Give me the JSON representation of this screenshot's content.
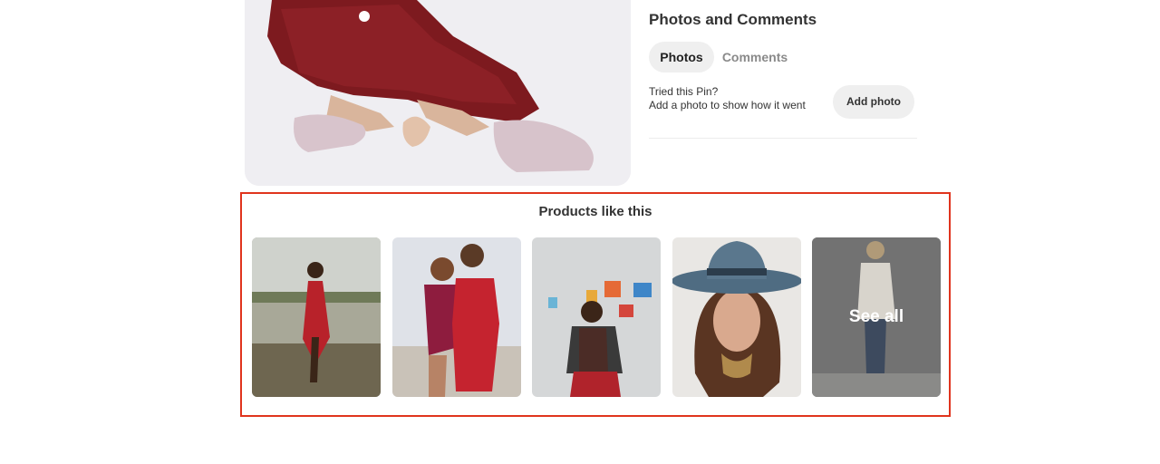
{
  "pin_image": {
    "alt_icon": "pin-photo-red-floral-dress"
  },
  "panel": {
    "title": "Photos and Comments",
    "tabs": [
      {
        "label": "Photos",
        "active": true
      },
      {
        "label": "Comments",
        "active": false
      }
    ],
    "tried_line1": "Tried this Pin?",
    "tried_line2": "Add a photo to show how it went",
    "add_photo_label": "Add photo"
  },
  "products": {
    "title": "Products like this",
    "items": [
      {
        "icon": "product-photo-beach-dress"
      },
      {
        "icon": "product-photo-two-women-red-outfits"
      },
      {
        "icon": "product-photo-leather-jacket"
      },
      {
        "icon": "product-photo-blue-hat"
      },
      {
        "icon": "product-photo-cardigan-jeans"
      }
    ],
    "see_all_label": "See all",
    "highlight_color": "#e0341d"
  }
}
